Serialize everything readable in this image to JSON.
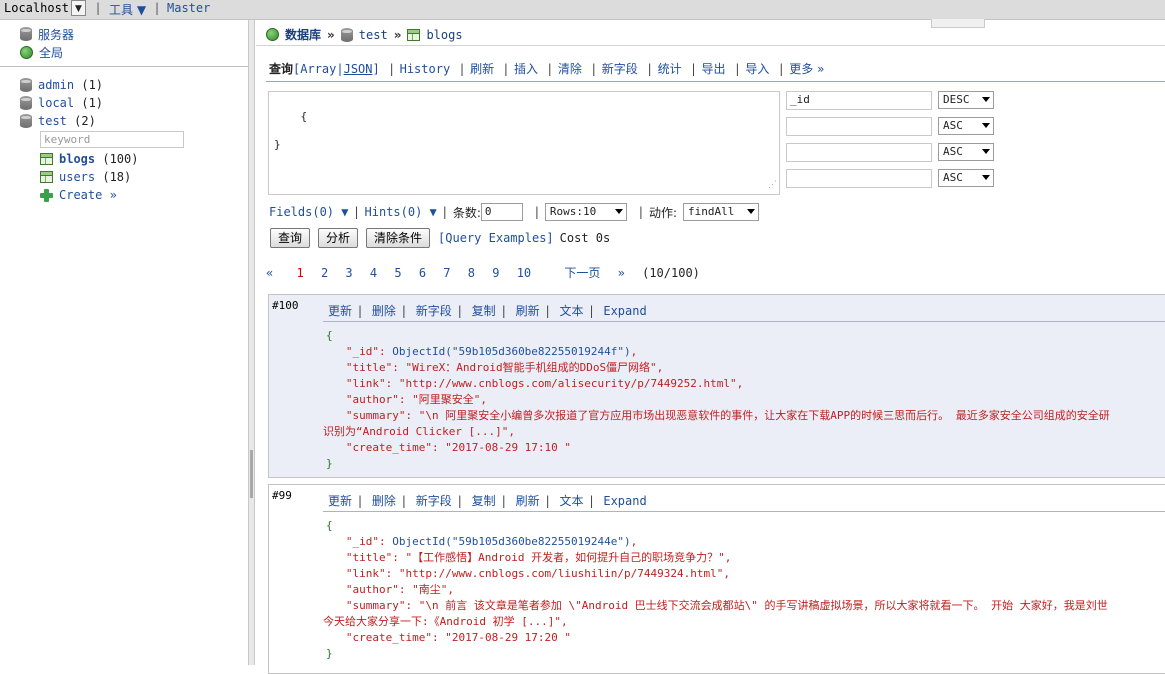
{
  "topbar": {
    "host": "Localhost",
    "tools": "工具 ▼",
    "master": "Master",
    "sep": "|"
  },
  "sidebar": {
    "server": "服务器",
    "global": "全局",
    "dbs": [
      {
        "name": "admin",
        "count": "(1)"
      },
      {
        "name": "local",
        "count": "(1)"
      },
      {
        "name": "test",
        "count": "(2)"
      }
    ],
    "keyword_placeholder": "keyword",
    "collections": [
      {
        "name": "blogs",
        "count": "(100)"
      },
      {
        "name": "users",
        "count": "(18)"
      }
    ],
    "create": "Create »"
  },
  "breadcrumb": {
    "db_label": "数据库",
    "arrow": "»",
    "db": "test",
    "collection": "blogs"
  },
  "menu": {
    "query": "查询",
    "array_open": "[Array|",
    "json": "JSON",
    "array_close": "]",
    "history": "History",
    "refresh": "刷新",
    "insert": "插入",
    "clear": "清除",
    "new_field": "新字段",
    "stats": "统计",
    "export": "导出",
    "import": "导入",
    "more": "更多 »",
    "sep": "|"
  },
  "query": {
    "text": "{\n\n}",
    "sort_fields": [
      "_id",
      "",
      "",
      ""
    ],
    "sort_orders": [
      "DESC",
      "ASC",
      "ASC",
      "ASC"
    ]
  },
  "options": {
    "fields": "Fields(0) ▼",
    "hints": "Hints(0) ▼",
    "limit_label": "条数:",
    "limit_value": "0",
    "rows": "Rows:10",
    "action_label": "动作:",
    "action": "findAll",
    "sep": "|"
  },
  "buttons": {
    "query": "查询",
    "analyze": "分析",
    "clear_conditions": "清除条件",
    "examples": "[Query Examples]",
    "cost": "Cost 0s"
  },
  "pager": {
    "prev": "«",
    "pages": [
      "1",
      "2",
      "3",
      "4",
      "5",
      "6",
      "7",
      "8",
      "9",
      "10"
    ],
    "next_page": "下一页",
    "next": "»",
    "total": "(10/100)"
  },
  "record_actions": [
    "更新",
    "删除",
    "新字段",
    "复制",
    "刷新",
    "文本",
    "Expand"
  ],
  "records": [
    {
      "num": "#100",
      "open": "{",
      "id_key": "\"_id\": ",
      "id_val": "ObjectId(\"59b105d360be82255019244f\")",
      "title_line": "\"title\": \"WireX：Android智能手机组成的DDoS僵尸网络\",",
      "link_line": "\"link\": \"http://www.cnblogs.com/alisecurity/p/7449252.html\",",
      "author_line": "\"author\": \"阿里聚安全\",",
      "summary_line": "\"summary\": \"\\n 阿里聚安全小编曾多次报道了官方应用市场出现恶意软件的事件，让大家在下载APP的时候三思而后行。 最近多家安全公司组成的安全研",
      "summary_cont": "识别为“Android Clicker [...]\",",
      "time_line": "\"create_time\": \"2017-08-29 17:10 \"",
      "close": "}"
    },
    {
      "num": "#99",
      "open": "{",
      "id_key": "\"_id\": ",
      "id_val": "ObjectId(\"59b105d360be82255019244e\")",
      "title_line": "\"title\": \"【工作感悟】Android 开发者，如何提升自己的职场竞争力？\",",
      "link_line": "\"link\": \"http://www.cnblogs.com/liushilin/p/7449324.html\",",
      "author_line": "\"author\": \"南尘\",",
      "summary_line": "\"summary\": \"\\n 前言 该文章是笔者参加 \\\"Android 巴士线下交流会成都站\\\" 的手写讲稿虚拟场景，所以大家将就看一下。 开始 大家好，我是刘世",
      "summary_cont": "今天给大家分享一下:《Android 初学 [...]\",",
      "time_line": "\"create_time\": \"2017-08-29 17:20 \"",
      "close": "}"
    }
  ],
  "colors": {
    "link": "#1f4f9a",
    "doc_text": "#c02020",
    "current_page": "#dd0000",
    "record_bg": "#eceef7"
  }
}
